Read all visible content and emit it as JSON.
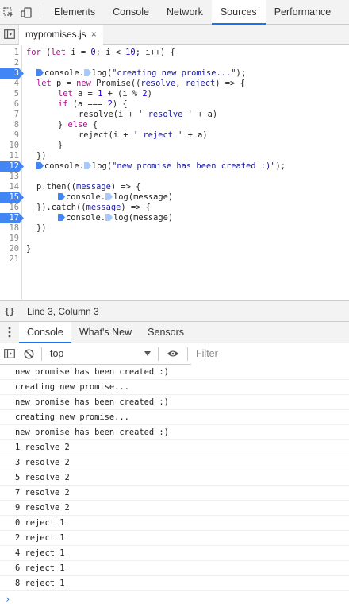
{
  "toolbar": {
    "inspect_icon": "inspect-element-icon",
    "device_icon": "device-toolbar-icon",
    "tabs": [
      {
        "label": "Elements",
        "active": false
      },
      {
        "label": "Console",
        "active": false
      },
      {
        "label": "Network",
        "active": false
      },
      {
        "label": "Sources",
        "active": true
      },
      {
        "label": "Performance",
        "active": false
      }
    ]
  },
  "file_tab": {
    "name": "mypromises.js",
    "close_symbol": "×"
  },
  "editor": {
    "lines": [
      {
        "n": "1",
        "bp": false
      },
      {
        "n": "2",
        "bp": false
      },
      {
        "n": "3",
        "bp": true
      },
      {
        "n": "4",
        "bp": false
      },
      {
        "n": "5",
        "bp": false
      },
      {
        "n": "6",
        "bp": false
      },
      {
        "n": "7",
        "bp": false
      },
      {
        "n": "8",
        "bp": false
      },
      {
        "n": "9",
        "bp": false
      },
      {
        "n": "10",
        "bp": false
      },
      {
        "n": "11",
        "bp": false
      },
      {
        "n": "12",
        "bp": true
      },
      {
        "n": "13",
        "bp": false
      },
      {
        "n": "14",
        "bp": false
      },
      {
        "n": "15",
        "bp": true
      },
      {
        "n": "16",
        "bp": false
      },
      {
        "n": "17",
        "bp": true
      },
      {
        "n": "18",
        "bp": false
      },
      {
        "n": "19",
        "bp": false
      },
      {
        "n": "20",
        "bp": false
      },
      {
        "n": "21",
        "bp": false
      }
    ],
    "code": {
      "l1_for": "for",
      "l1_a": " (",
      "l1_let": "let",
      "l1_b": " i = ",
      "l1_zero": "0",
      "l1_c": "; i < ",
      "l1_ten": "10",
      "l1_d": "; i++) {",
      "l3_a": "console.",
      "l3_b": "log(",
      "l3_str": "\"creating new promise...\"",
      "l3_c": ");",
      "l4_let": "let",
      "l4_a": " p = ",
      "l4_new": "new",
      "l4_b": " Promise((",
      "l4_p1": "resolve",
      "l4_c": ", ",
      "l4_p2": "reject",
      "l4_d": ") => {",
      "l5_let": "let",
      "l5_a": " a = ",
      "l5_one": "1",
      "l5_b": " + (i % ",
      "l5_two": "2",
      "l5_c": ")",
      "l6_if": "if",
      "l6_a": " (a === ",
      "l6_two": "2",
      "l6_b": ") {",
      "l7_a": "resolve(i + ",
      "l7_str": "' resolve '",
      "l7_b": " + a)",
      "l8_a": "} ",
      "l8_else": "else",
      "l8_b": " {",
      "l9_a": "reject(i + ",
      "l9_str": "' reject '",
      "l9_b": " + a)",
      "l10": "}",
      "l11": "})",
      "l12_a": "console.",
      "l12_b": "log(",
      "l12_str": "\"new promise has been created :)\"",
      "l12_c": ");",
      "l14_a": "p.then((",
      "l14_p": "message",
      "l14_b": ") => {",
      "l15_a": "console.",
      "l15_b": "log(message)",
      "l16_a": "}).catch((",
      "l16_p": "message",
      "l16_b": ") => {",
      "l17_a": "console.",
      "l17_b": "log(message)",
      "l18": "})",
      "l20": "}"
    }
  },
  "status": {
    "icon": "pretty-print-icon",
    "position": "Line 3, Column 3"
  },
  "drawer": {
    "tabs": [
      {
        "label": "Console",
        "active": true
      },
      {
        "label": "What's New",
        "active": false
      },
      {
        "label": "Sensors",
        "active": false
      }
    ]
  },
  "console_toolbar": {
    "context": "top",
    "filter_placeholder": "Filter"
  },
  "console": {
    "messages": [
      "new promise has been created :)",
      "creating new promise...",
      "new promise has been created :)",
      "creating new promise...",
      "new promise has been created :)",
      "1 resolve 2",
      "3 resolve 2",
      "5 resolve 2",
      "7 resolve 2",
      "9 resolve 2",
      "0 reject 1",
      "2 reject 1",
      "4 reject 1",
      "6 reject 1",
      "8 reject 1"
    ],
    "prompt_symbol": "›"
  },
  "colors": {
    "accent": "#1a73e8",
    "breakpoint": "#4285f4",
    "keyword": "#aa0d91",
    "string": "#1a1aa6"
  }
}
